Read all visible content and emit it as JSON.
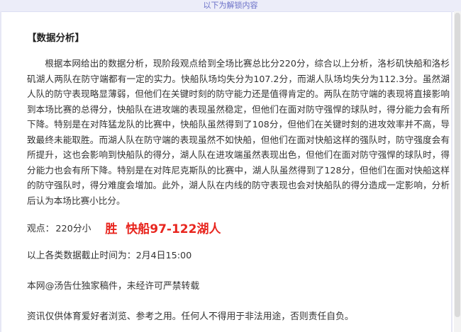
{
  "banner": {
    "text": "以下为解锁内容"
  },
  "article": {
    "section_title": "【数据分析】",
    "paragraph": "根据本网给出的数据分析，现阶段观点给到全场比赛总比分220分，综合以上分析，洛杉矶快船和洛杉矶湖人两队在防守端都有一定的实力。快船队场均失分为107.2分，而湖人队场均失分为112.3分。虽然湖人队的防守表现略显薄弱，但他们在关键时刻的防守能力还是值得肯定的。两队在防守端的表现将直接影响到本场比赛的总得分，快船队在进攻端的表现虽然稳定，但他们在面对防守强悍的球队时，得分能力会有所下降。特别是在对阵猛龙队的比赛中，快船队虽然得到了108分，但他们在关键时刻的进攻效率并不高，导致最终未能取胜。而湖人队在防守端的表现虽然不如快船，但他们在面对快船这样的强队时，防守强度会有所提升，这也会影响到快船队的得分，湖人队在进攻端虽然表现出色，但他们在面对防守强悍的球队时，得分能力也会有所下降。特别是在对阵尼克斯队的比赛中，湖人队虽然得到了128分，但他们在面对快船这样的防守强队时，得分难度会增加。此外，湖人队在内线的防守表现也会对快船队的得分造成一定影响，分析后认为本场比赛小比分。",
    "prediction": {
      "label": "观点：",
      "value": "220分小",
      "result": "胜  快船97-122湖人"
    },
    "cutoff": "以上各类数据截止时间为：2月4日15:00",
    "copyright": "本网@汤告仕独家稿件，未经许可严禁转载",
    "disclaimer": "资讯仅供体育爱好者浏览、参考之用。任何人不得用于非法用途，否则责任自负。"
  },
  "colors": {
    "banner_bg": "#ecedf9",
    "banner_text": "#6b71c8",
    "result_red": "#e8261f"
  }
}
